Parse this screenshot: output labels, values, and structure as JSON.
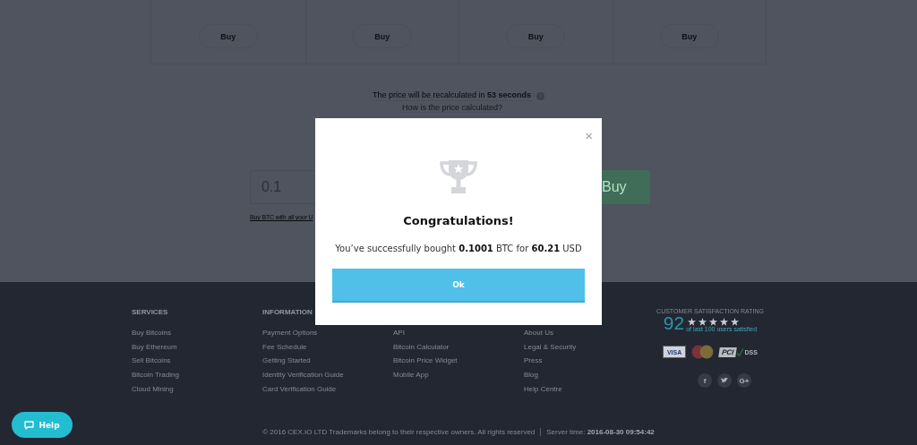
{
  "product_cards": [
    {
      "button": "Buy"
    },
    {
      "button": "Buy"
    },
    {
      "button": "Buy"
    },
    {
      "button": "Buy"
    }
  ],
  "price_notice": {
    "text": "The price will be recalculated in **53 seconds**",
    "link": "How is the price calculated?"
  },
  "order_form": {
    "amount": "0.1",
    "button": "Buy",
    "all_funds_link": "Buy BTC with all your U"
  },
  "footer": {
    "columns": [
      {
        "heading": "SERVICES",
        "links": [
          "Buy Bitcoins",
          "Buy Ethereum",
          "Sell Bitcoins",
          "Bitcoin Trading",
          "Cloud Mining"
        ]
      },
      {
        "heading": "INFORMATION",
        "links": [
          "Payment Options",
          "Fee Schedule",
          "Getting Started",
          "Identity Verification Guide",
          "Card Verification Guide"
        ]
      },
      {
        "links": [
          "API",
          "Bitcoin Calculator",
          "Bitcoin Price Widget",
          "Mobile App"
        ]
      },
      {
        "links": [
          "About Us",
          "Legal & Security",
          "Press",
          "Blog",
          "Help Centre"
        ]
      }
    ],
    "rating": {
      "caption": "CUSTOMER SATISFACTION RATING",
      "score": "92",
      "stars": 5,
      "subtitle": "of last 100 users satisfied"
    },
    "payment_badges": [
      {
        "kind": "visa",
        "label": "VISA"
      },
      {
        "kind": "mastercard"
      },
      {
        "kind": "pci",
        "label": "PCI",
        "sublabel": "DSS"
      }
    ],
    "social": [
      {
        "kind": "facebook",
        "glyph": "f"
      },
      {
        "kind": "twitter"
      },
      {
        "kind": "googleplus",
        "glyph": "G+"
      }
    ],
    "copyright": "© 2016 CEX.IO LTD Trademarks belong to their respective owners. All rights reserved",
    "server_time_label": "Server time:",
    "server_time": "2016-08-30 09:54:42"
  },
  "help_button": "Help",
  "dialog": {
    "close": "×",
    "title": "Congratulations!",
    "message": "You’ve successfully bought **0.1001** BTC for **60.21** USD",
    "button": "Ok"
  }
}
